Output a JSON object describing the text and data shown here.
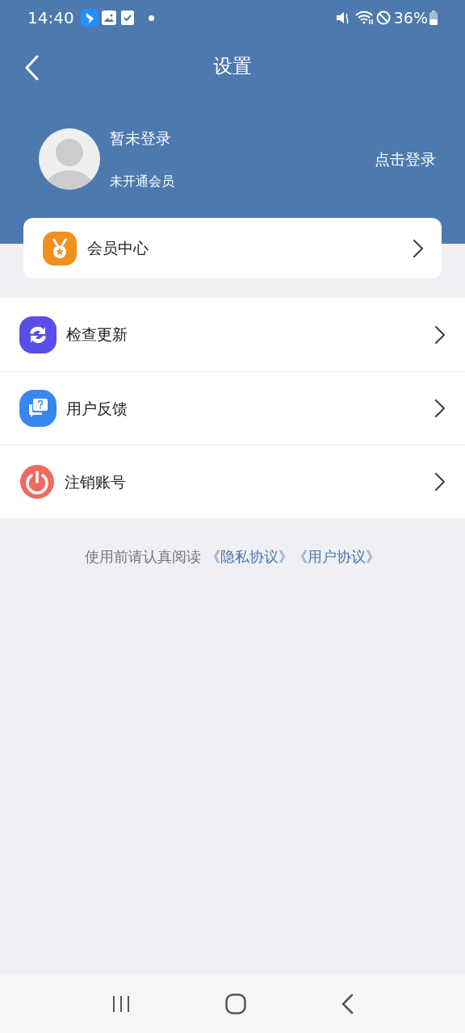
{
  "status_bar": {
    "time": "14:40",
    "battery": "36%"
  },
  "header": {
    "title": "设置"
  },
  "profile": {
    "name": "暂未登录",
    "membership": "未开通会员",
    "login_action": "点击登录"
  },
  "member_card": {
    "label": "会员中心"
  },
  "menu": [
    {
      "kind": "refresh",
      "label": "检查更新"
    },
    {
      "kind": "feedback",
      "label": "用户反馈"
    },
    {
      "kind": "power",
      "label": "注销账号"
    }
  ],
  "footer": {
    "text": "使用前请认真阅读",
    "links": [
      "《隐私协议》",
      "《用户协议》"
    ]
  }
}
